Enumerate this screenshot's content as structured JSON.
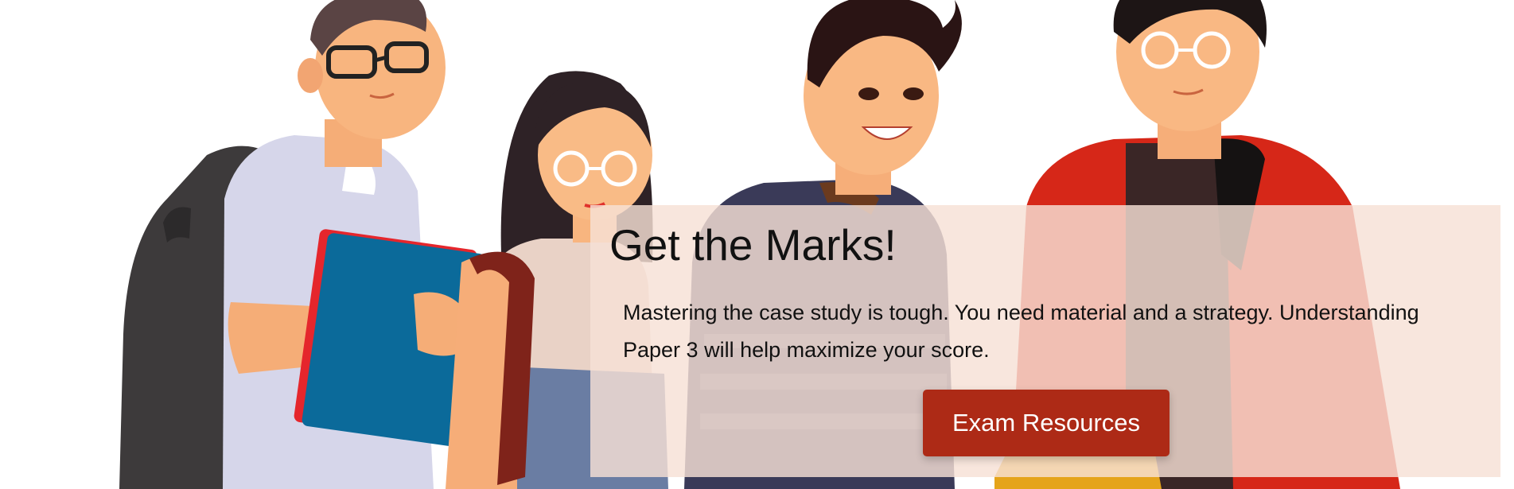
{
  "hero": {
    "title": "Get the Marks!",
    "description": "Mastering the case study is tough. You need material and a strategy. Understanding Paper 3 will help maximize your score.",
    "button_label": "Exam Resources"
  },
  "colors": {
    "button": "#ad2a16",
    "overlay": "#f6e0d6",
    "background": "#ffffff"
  },
  "illustration": {
    "subject": "group-of-students-illustration"
  }
}
